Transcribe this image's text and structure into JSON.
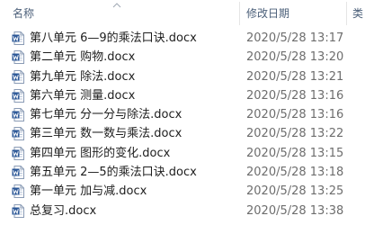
{
  "header": {
    "name_label": "名称",
    "date_label": "修改日期",
    "type_label": "类"
  },
  "icons": {
    "file": "word-doc-icon",
    "sort": "sort-up-icon"
  },
  "colors": {
    "word_blue": "#2b5797",
    "header_text": "#4c607a"
  },
  "files": [
    {
      "name": "第八单元  6—9的乘法口诀.docx",
      "date": "2020/5/28 13:17"
    },
    {
      "name": "第二单元  购物.docx",
      "date": "2020/5/28 13:20"
    },
    {
      "name": "第九单元  除法.docx",
      "date": "2020/5/28 13:21"
    },
    {
      "name": "第六单元  测量.docx",
      "date": "2020/5/28 13:16"
    },
    {
      "name": "第七单元  分一分与除法.docx",
      "date": "2020/5/28 13:16"
    },
    {
      "name": "第三单元  数一数与乘法.docx",
      "date": "2020/5/28 13:22"
    },
    {
      "name": "第四单元  图形的变化.docx",
      "date": "2020/5/28 13:15"
    },
    {
      "name": "第五单元  2—5的乘法口诀.docx",
      "date": "2020/5/28 13:18"
    },
    {
      "name": "第一单元  加与减.docx",
      "date": "2020/5/28 13:25"
    },
    {
      "name": "总复习.docx",
      "date": "2020/5/28 13:38"
    }
  ]
}
